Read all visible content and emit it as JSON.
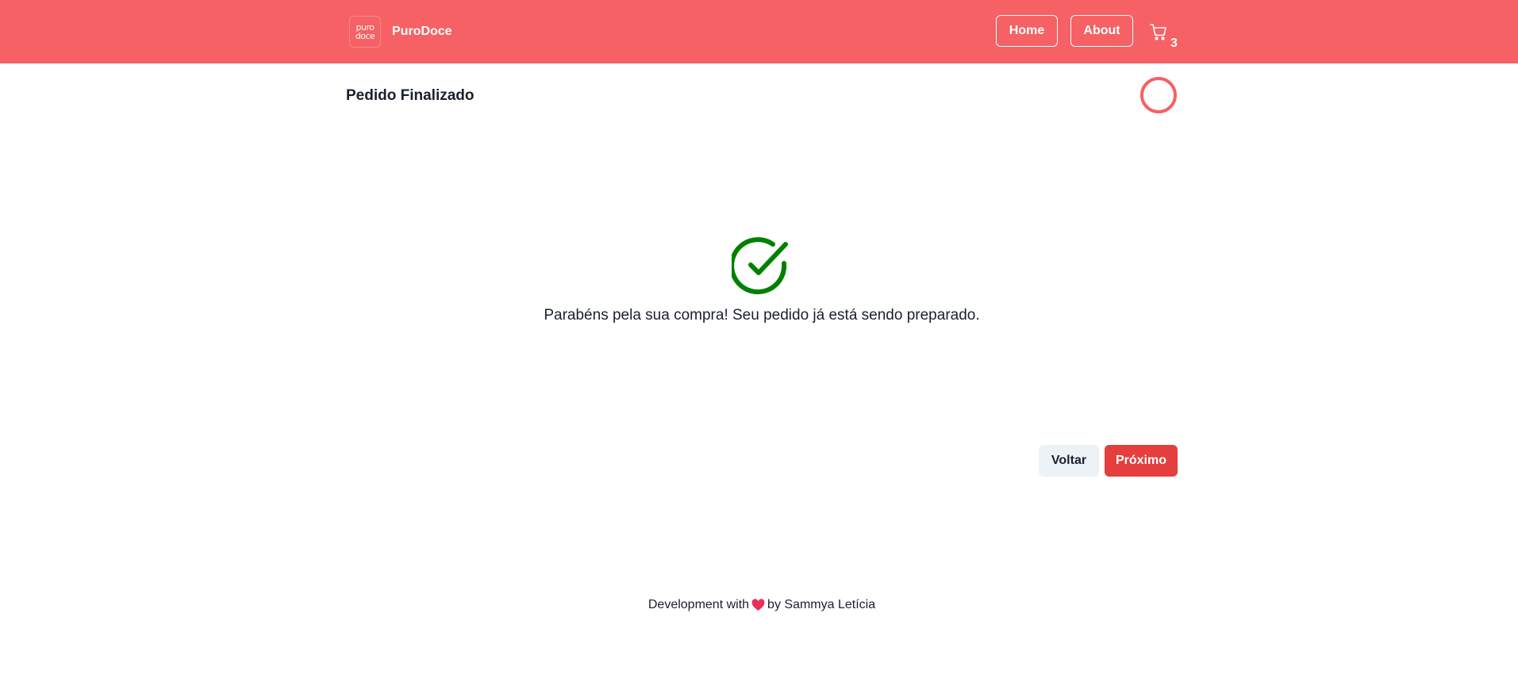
{
  "header": {
    "logo_lines": [
      "puro",
      "doce"
    ],
    "brand_name": "PuroDoce",
    "nav": {
      "home_label": "Home",
      "about_label": "About"
    },
    "cart_icon": "cart-icon",
    "cart_count": "3"
  },
  "step": {
    "title": "Pedido Finalizado"
  },
  "main": {
    "status_icon": "check-circle-icon",
    "message": "Parabéns pela sua compra! Seu pedido já está sendo preparado."
  },
  "actions": {
    "back_label": "Voltar",
    "next_label": "Próximo"
  },
  "footer": {
    "prefix": "Development with",
    "suffix": "by Sammya Letícia",
    "icon": "heart-icon"
  },
  "colors": {
    "header_bg": "#f56164",
    "accent_red": "#e53e3e",
    "success_green": "#008000",
    "heart": "#e8305b",
    "back_button_bg": "#edf2f7"
  }
}
